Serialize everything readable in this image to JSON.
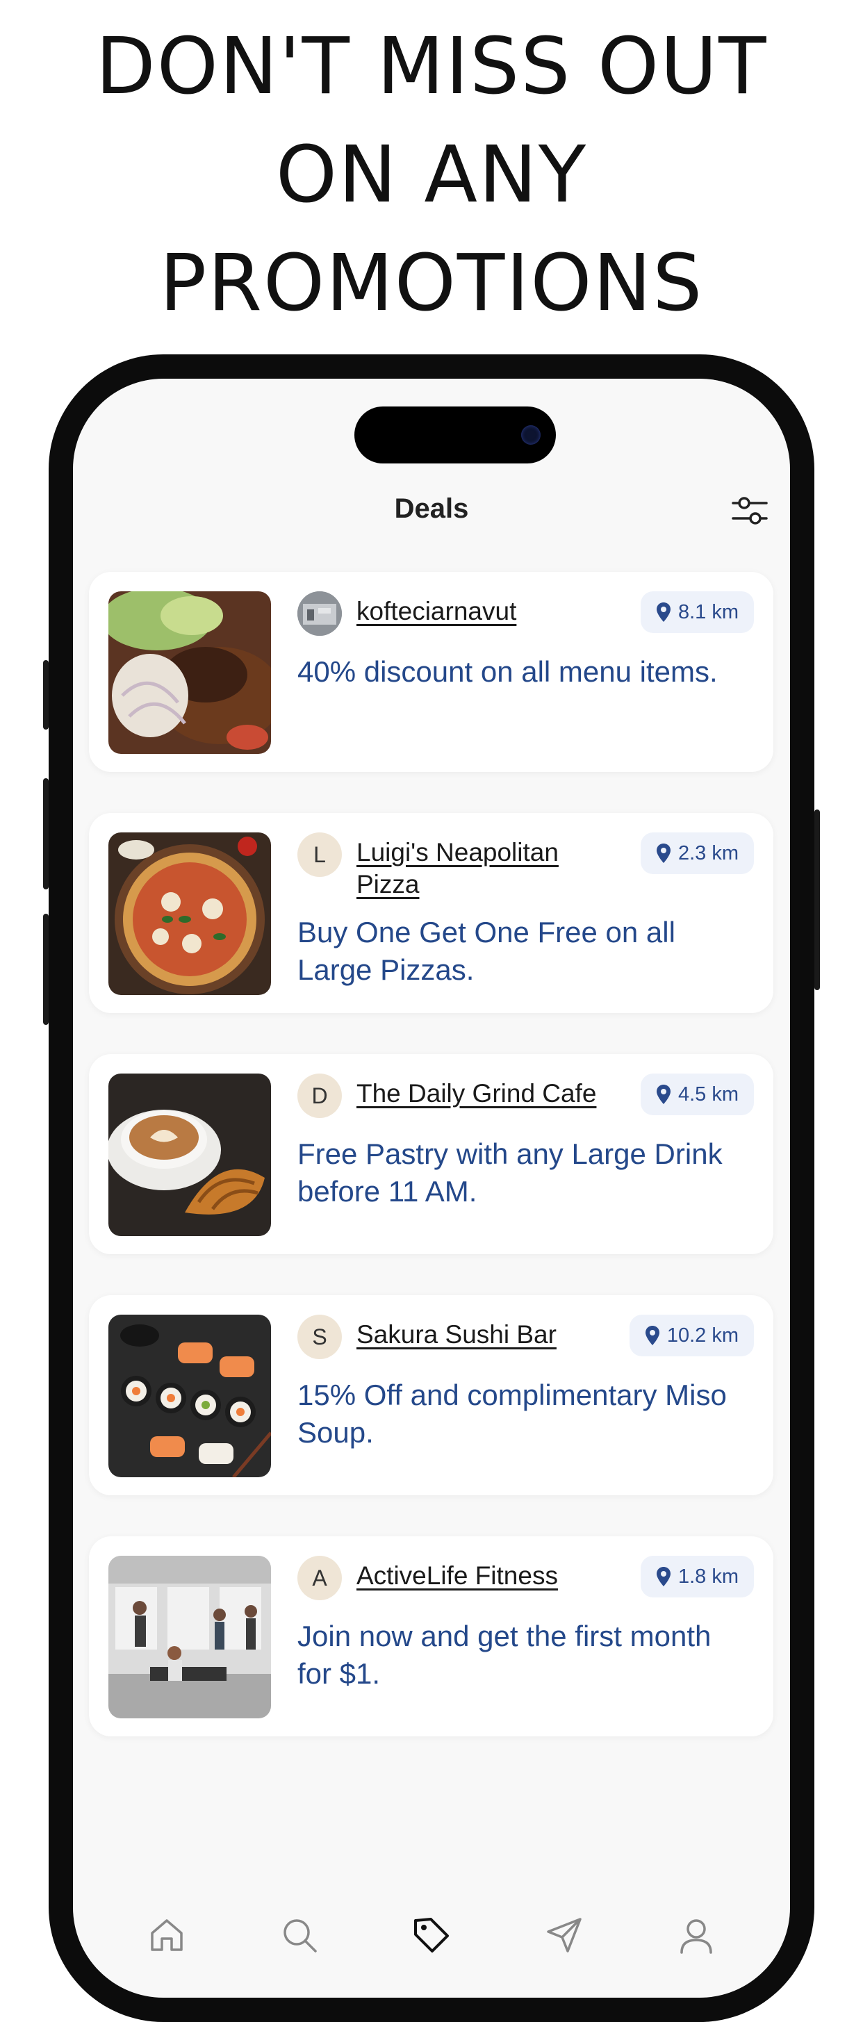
{
  "headline": {
    "line1": "DON'T MISS OUT",
    "line2": "ON ANY",
    "line3": "PROMOTIONS"
  },
  "app": {
    "title": "Deals",
    "filter_icon": "sliders-icon"
  },
  "deals": [
    {
      "business": "kofteciarnavut",
      "avatar": "",
      "avatar_type": "photo",
      "distance": "8.1 km",
      "description": "40% discount on all menu items.",
      "image": "grilled meat with salad"
    },
    {
      "business": "Luigi's Neapolitan Pizza",
      "avatar": "L",
      "avatar_type": "letter",
      "distance": "2.3 km",
      "description": "Buy One Get One Free on all Large Pizzas.",
      "image": "pizza"
    },
    {
      "business": "The Daily Grind Cafe",
      "avatar": "D",
      "avatar_type": "letter",
      "distance": "4.5 km",
      "description": "Free Pastry with any Large Drink before 11 AM.",
      "image": "latte and croissant"
    },
    {
      "business": "Sakura Sushi Bar",
      "avatar": "S",
      "avatar_type": "letter",
      "distance": "10.2 km",
      "description": "15% Off and complimentary Miso Soup.",
      "image": "sushi platter"
    },
    {
      "business": "ActiveLife Fitness",
      "avatar": "A",
      "avatar_type": "letter",
      "distance": "1.8 km",
      "description": "Join now and get the first month for $1.",
      "image": "gym"
    }
  ],
  "tabs": [
    {
      "icon": "home-icon",
      "active": false
    },
    {
      "icon": "search-icon",
      "active": false
    },
    {
      "icon": "tag-icon",
      "active": true
    },
    {
      "icon": "send-icon",
      "active": false
    },
    {
      "icon": "profile-icon",
      "active": false
    }
  ],
  "colors": {
    "accent": "#24488a",
    "badge_bg": "#eef2fa",
    "background": "#f8f8f8"
  }
}
